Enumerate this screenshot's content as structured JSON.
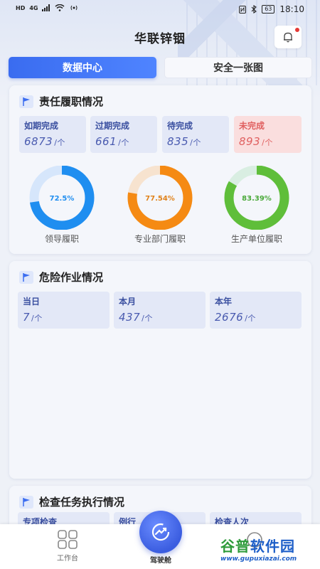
{
  "status_bar": {
    "left": [
      "HD",
      "4G"
    ],
    "battery": "63",
    "time": "18:10"
  },
  "header": {
    "title": "华联锌铟"
  },
  "tabs": [
    {
      "label": "数据中心",
      "active": true
    },
    {
      "label": "安全一张图",
      "active": false
    }
  ],
  "responsibility": {
    "title": "责任履职情况",
    "stats": [
      {
        "label": "如期完成",
        "value": "6873",
        "unit": "/个"
      },
      {
        "label": "过期完成",
        "value": "661",
        "unit": "/个"
      },
      {
        "label": "待完成",
        "value": "835",
        "unit": "/个"
      },
      {
        "label": "未完成",
        "value": "893",
        "unit": "/个"
      }
    ],
    "donuts": [
      {
        "label": "领导履职",
        "percent_text": "72.5%",
        "percent": 72.5,
        "color": "#1f8ef0",
        "track": "#d6e6fb",
        "text_color": "#1f8ef0"
      },
      {
        "label": "专业部门履职",
        "percent_text": "77.54%",
        "percent": 77.54,
        "color": "#f58a13",
        "track": "#f7e3cf",
        "text_color": "#e0821a"
      },
      {
        "label": "生产单位履职",
        "percent_text": "83.39%",
        "percent": 83.39,
        "color": "#5fbe3a",
        "track": "#d9eee2",
        "text_color": "#4aa93a"
      }
    ]
  },
  "danger": {
    "title": "危险作业情况",
    "stats": [
      {
        "label": "当日",
        "value": "7",
        "unit": "/个"
      },
      {
        "label": "本月",
        "value": "437",
        "unit": "/个"
      },
      {
        "label": "本年",
        "value": "2676",
        "unit": "/个"
      }
    ]
  },
  "inspection": {
    "title": "检查任务执行情况",
    "stats": [
      "专项检查",
      "例行",
      "检查人次"
    ]
  },
  "bottom_nav": {
    "left": "工作台",
    "center": "驾驶舱"
  },
  "watermark": {
    "big_green": "谷普",
    "big_blue": "软件园",
    "small": "www.gupuxiazai.com"
  }
}
